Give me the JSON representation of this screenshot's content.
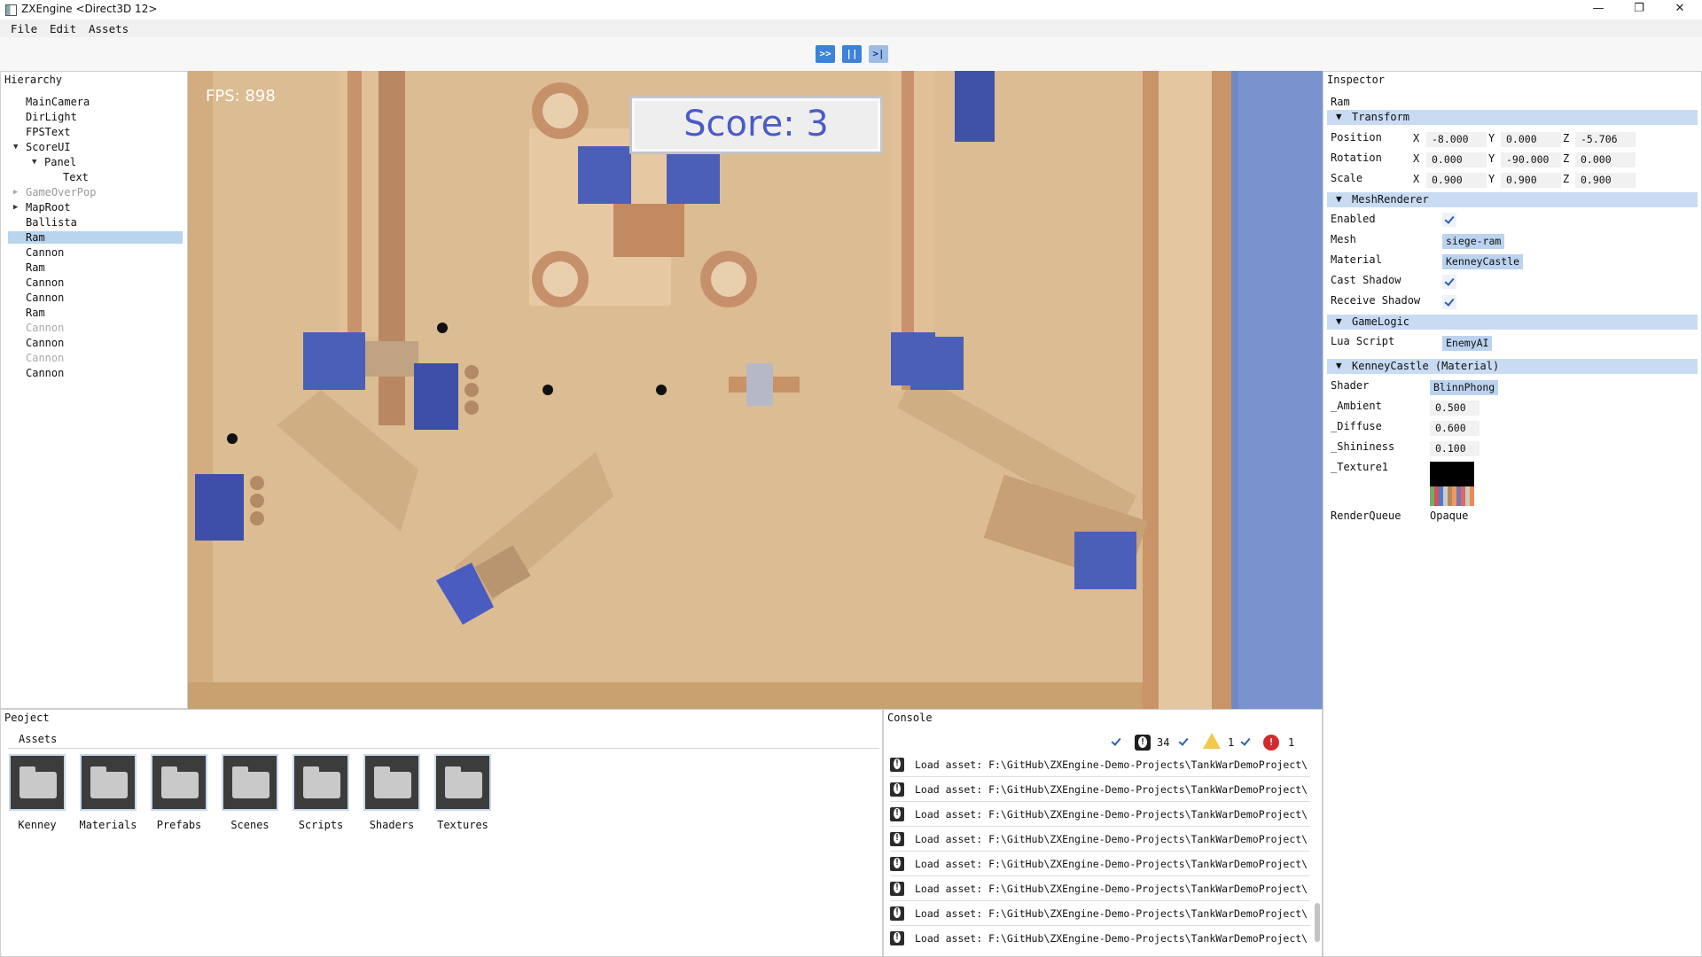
{
  "window": {
    "title": "ZXEngine <Direct3D 12>",
    "minimize": "—",
    "maximize": "❐",
    "close": "✕"
  },
  "menu": [
    "File",
    "Edit",
    "Assets"
  ],
  "toolbar": {
    "play": ">>",
    "pause": "||",
    "step": ">|",
    "accent": "#3b82d9"
  },
  "hierarchy": {
    "title": "Hierarchy",
    "items": [
      "MainCamera",
      "DirLight",
      "FPSText",
      "ScoreUI",
      "Panel",
      "Text",
      "GameOverPop",
      "MapRoot",
      "Ballista",
      "Ram",
      "Cannon",
      "Ram",
      "Cannon",
      "Cannon",
      "Ram",
      "Cannon",
      "Cannon",
      "Cannon",
      "Cannon"
    ],
    "selected": "Ram"
  },
  "game": {
    "fps": "FPS: 898",
    "score": "Score: 3"
  },
  "inspector": {
    "title": "Inspector",
    "object": "Ram",
    "transform": {
      "header": "Transform",
      "position_label": "Position",
      "rotation_label": "Rotation",
      "scale_label": "Scale",
      "x": "X",
      "y": "Y",
      "z": "Z",
      "position": [
        "-8.000",
        "0.000",
        "-5.706"
      ],
      "rotation": [
        "0.000",
        "-90.000",
        "0.000"
      ],
      "scale": [
        "0.900",
        "0.900",
        "0.900"
      ]
    },
    "mesh_renderer": {
      "header": "MeshRenderer",
      "enabled_label": "Enabled",
      "mesh_label": "Mesh",
      "material_label": "Material",
      "cast_shadow_label": "Cast Shadow",
      "receive_shadow_label": "Receive Shadow",
      "mesh": "siege-ram",
      "material": "KenneyCastle"
    },
    "game_logic": {
      "header": "GameLogic",
      "lua_label": "Lua Script",
      "lua": "EnemyAI"
    },
    "material": {
      "header": "KenneyCastle (Material)",
      "shader_label": "Shader",
      "shader": "BlinnPhong",
      "ambient_label": "_Ambient",
      "ambient": "0.500",
      "diffuse_label": "_Diffuse",
      "diffuse": "0.600",
      "shininess_label": "_Shininess",
      "shininess": "0.100",
      "texture_label": "_Texture1",
      "renderqueue_label": "RenderQueue",
      "renderqueue": "Opaque"
    }
  },
  "project": {
    "title": "Peoject",
    "tab": "Assets",
    "folders": [
      "Kenney",
      "Materials",
      "Prefabs",
      "Scenes",
      "Scripts",
      "Shaders",
      "Textures"
    ]
  },
  "console": {
    "title": "Console",
    "info_count": "34",
    "warn_count": "1",
    "error_count": "1",
    "lines": [
      "Load asset: F:\\GitHub\\ZXEngine-Demo-Projects\\TankWarDemoProject\\",
      "Load asset: F:\\GitHub\\ZXEngine-Demo-Projects\\TankWarDemoProject\\",
      "Load asset: F:\\GitHub\\ZXEngine-Demo-Projects\\TankWarDemoProject\\",
      "Load asset: F:\\GitHub\\ZXEngine-Demo-Projects\\TankWarDemoProject\\",
      "Load asset: F:\\GitHub\\ZXEngine-Demo-Projects\\TankWarDemoProject\\",
      "Load asset: F:\\GitHub\\ZXEngine-Demo-Projects\\TankWarDemoProject\\",
      "Load asset: F:\\GitHub\\ZXEngine-Demo-Projects\\TankWarDemoProject\\",
      "Load asset: F:\\GitHub\\ZXEngine-Demo-Projects\\TankWarDemoProject\\"
    ]
  }
}
